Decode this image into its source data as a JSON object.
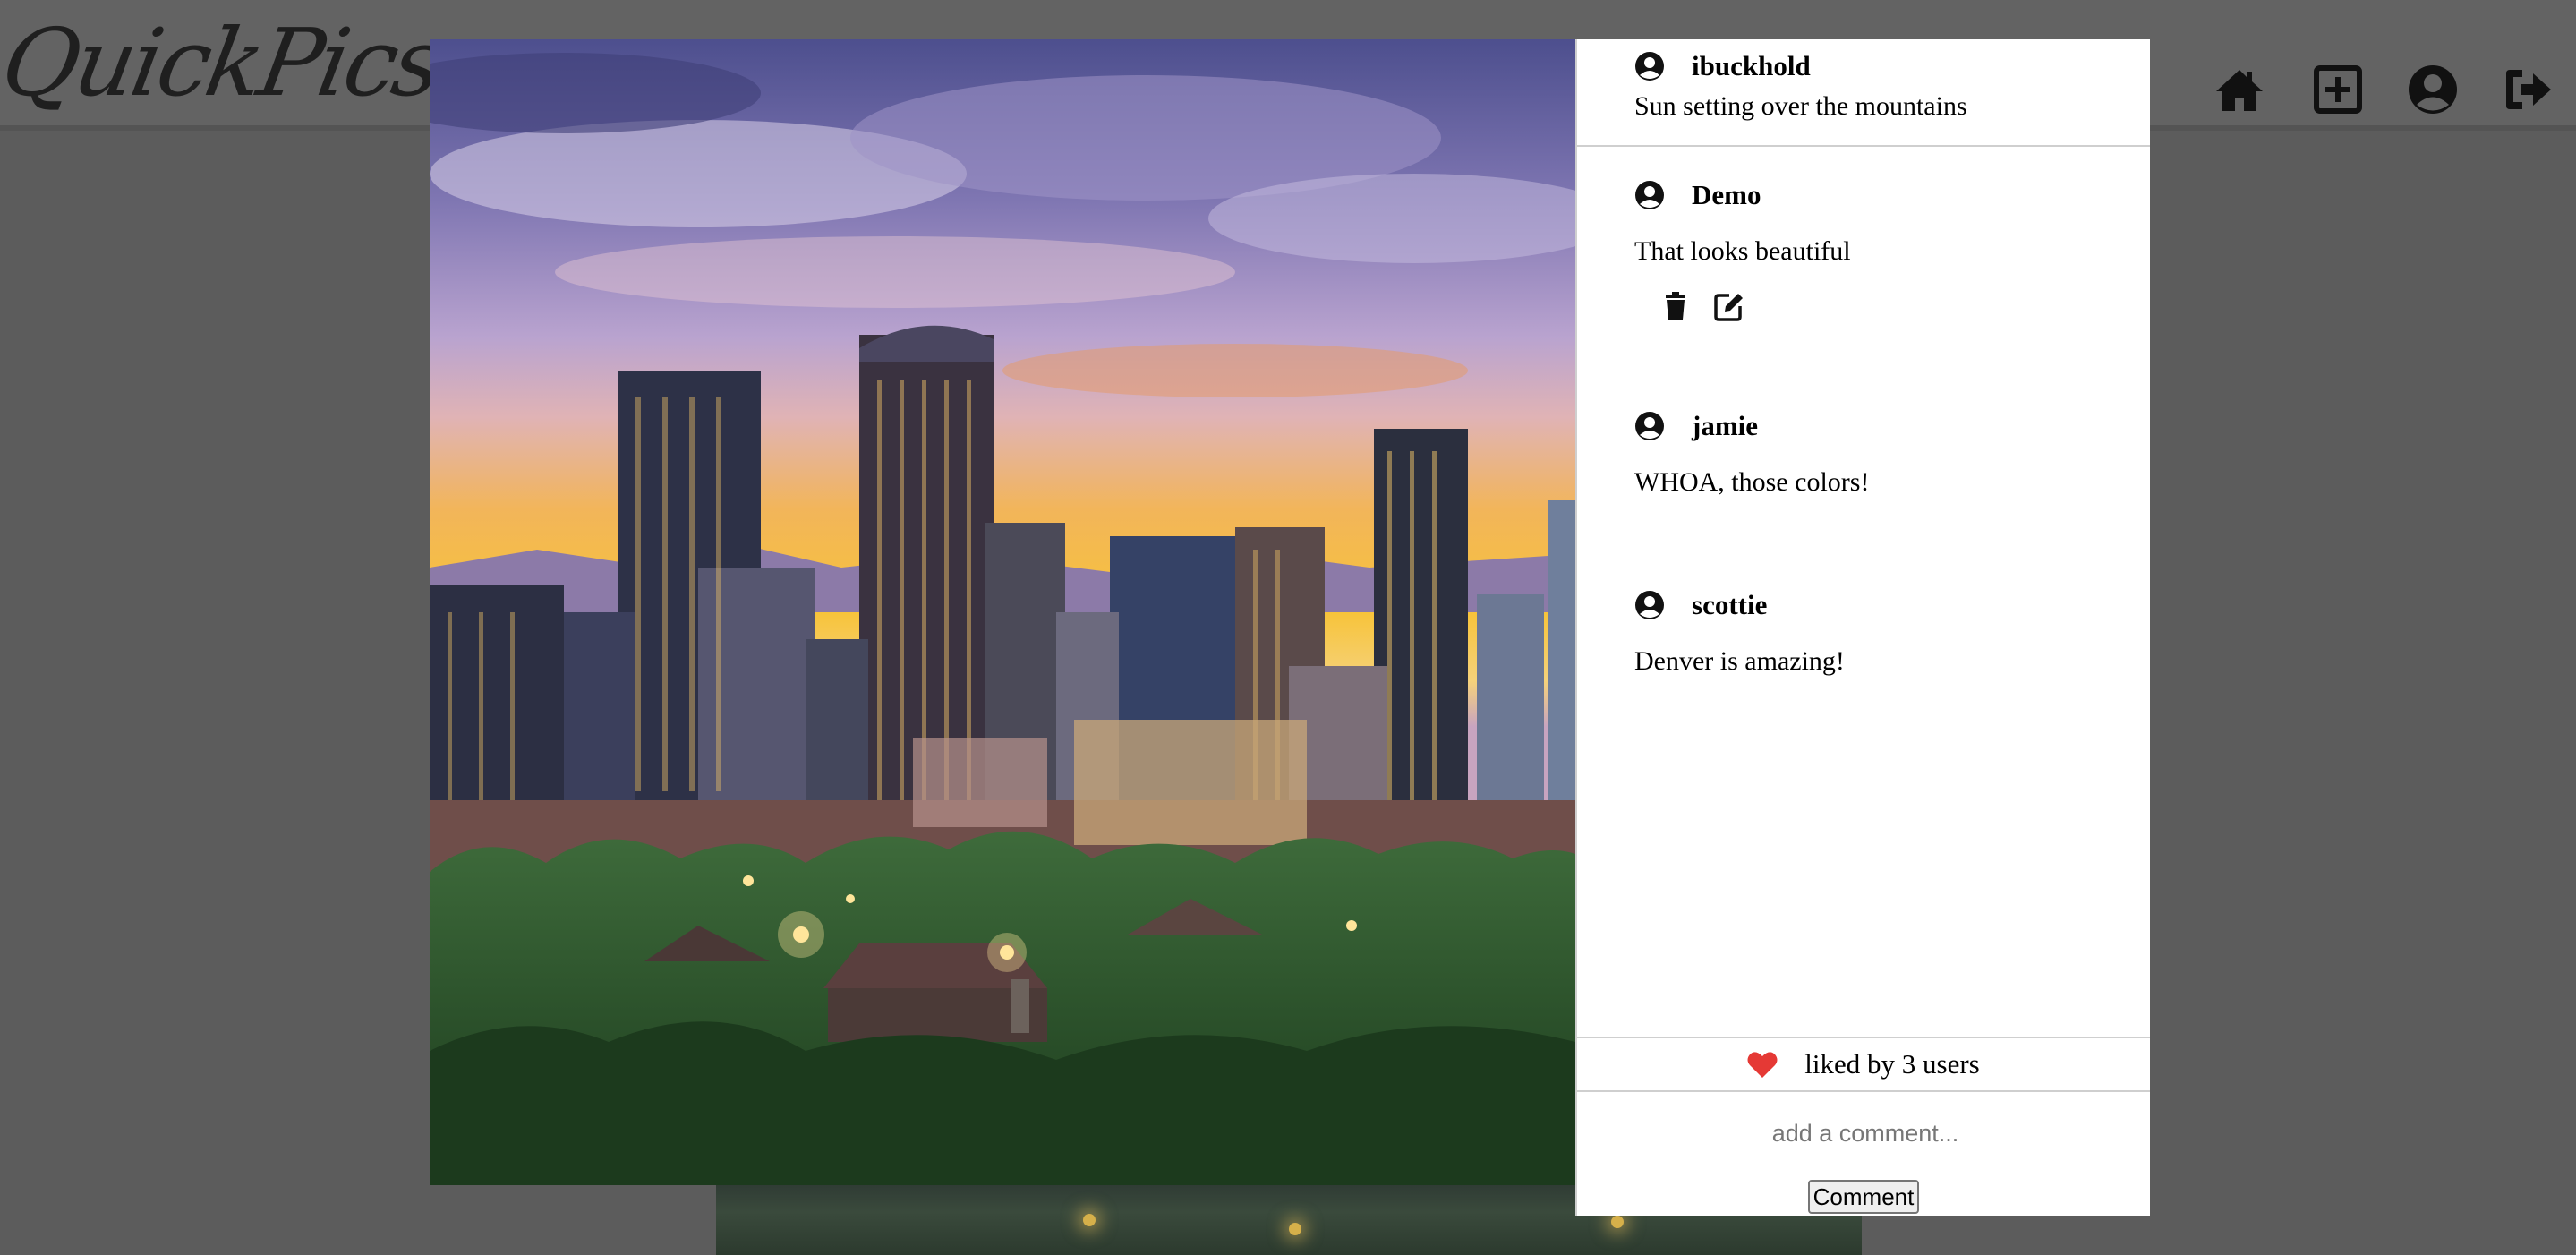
{
  "app": {
    "logo": "QuickPics"
  },
  "nav": {
    "icons": [
      "home-icon",
      "plus-square-icon",
      "user-circle-icon",
      "sign-out-icon"
    ]
  },
  "post": {
    "author": "ibuckhold",
    "caption": "Sun setting over the mountains",
    "comments": [
      {
        "user": "Demo",
        "text": "That looks beautiful",
        "editable": true
      },
      {
        "user": "jamie",
        "text": "WHOA, those colors!",
        "editable": false
      },
      {
        "user": "scottie",
        "text": "Denver is amazing!",
        "editable": false
      }
    ],
    "likes_text": "liked by 3 users",
    "heart_color": "#e53935"
  },
  "comment_form": {
    "placeholder": "add a comment...",
    "submit_label": "Comment"
  }
}
